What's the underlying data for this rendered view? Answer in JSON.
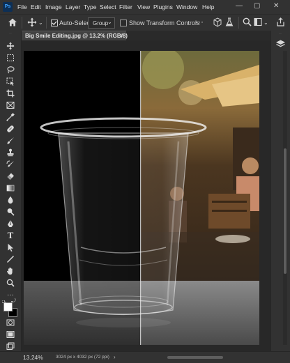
{
  "menu": {
    "app_logo": "Ps",
    "items": [
      "File",
      "Edit",
      "Image",
      "Layer",
      "Type",
      "Select",
      "Filter",
      "View",
      "Plugins",
      "Window",
      "Help"
    ]
  },
  "window_controls": {
    "minimize": "—",
    "restore": "▢",
    "close": "✕"
  },
  "options_bar": {
    "auto_select_label": "Auto-Select:",
    "auto_select_value": "Group",
    "show_transform_label": "Show Transform Controls"
  },
  "document": {
    "tab_title": "Big Smile Editing.jpg @ 13.2% (RGB/8)",
    "tab_close": "×"
  },
  "status": {
    "zoom": "13.24%",
    "dimensions": "3024 px x 4032 px (72 ppi)"
  }
}
